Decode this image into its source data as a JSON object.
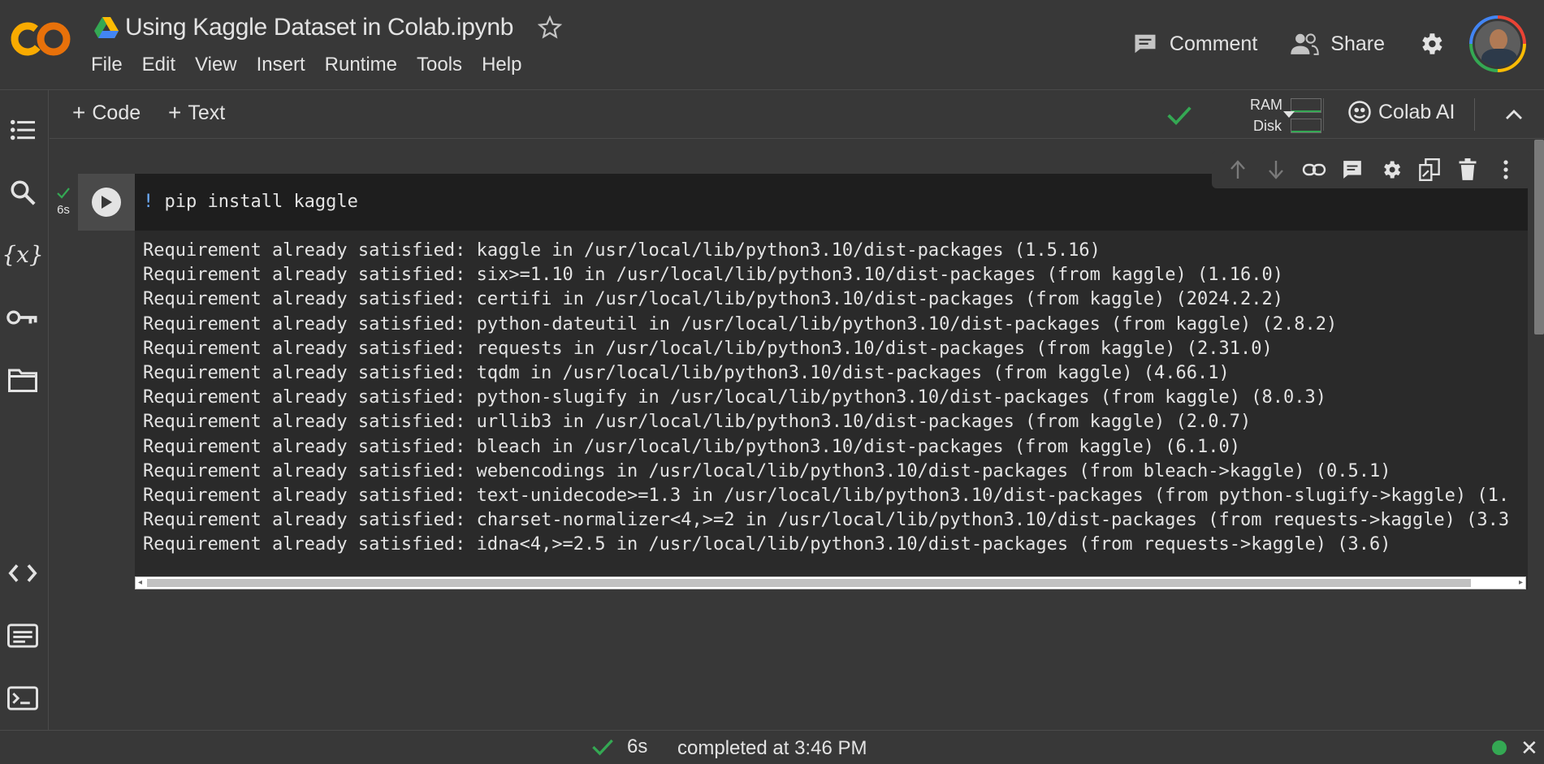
{
  "header": {
    "title": "Using Kaggle Dataset in Colab.ipynb",
    "menu": [
      "File",
      "Edit",
      "View",
      "Insert",
      "Runtime",
      "Tools",
      "Help"
    ],
    "comment_label": "Comment",
    "share_label": "Share"
  },
  "toolbar": {
    "add_code_label": "Code",
    "add_text_label": "Text",
    "ram_label": "RAM",
    "disk_label": "Disk",
    "colab_ai_label": "Colab AI"
  },
  "cell": {
    "exec_time": "6s",
    "code": "pip install kaggle",
    "code_prefix": "!",
    "output_lines": [
      "Requirement already satisfied: kaggle in /usr/local/lib/python3.10/dist-packages (1.5.16)",
      "Requirement already satisfied: six>=1.10 in /usr/local/lib/python3.10/dist-packages (from kaggle) (1.16.0)",
      "Requirement already satisfied: certifi in /usr/local/lib/python3.10/dist-packages (from kaggle) (2024.2.2)",
      "Requirement already satisfied: python-dateutil in /usr/local/lib/python3.10/dist-packages (from kaggle) (2.8.2)",
      "Requirement already satisfied: requests in /usr/local/lib/python3.10/dist-packages (from kaggle) (2.31.0)",
      "Requirement already satisfied: tqdm in /usr/local/lib/python3.10/dist-packages (from kaggle) (4.66.1)",
      "Requirement already satisfied: python-slugify in /usr/local/lib/python3.10/dist-packages (from kaggle) (8.0.3)",
      "Requirement already satisfied: urllib3 in /usr/local/lib/python3.10/dist-packages (from kaggle) (2.0.7)",
      "Requirement already satisfied: bleach in /usr/local/lib/python3.10/dist-packages (from kaggle) (6.1.0)",
      "Requirement already satisfied: webencodings in /usr/local/lib/python3.10/dist-packages (from bleach->kaggle) (0.5.1)",
      "Requirement already satisfied: text-unidecode>=1.3 in /usr/local/lib/python3.10/dist-packages (from python-slugify->kaggle) (1.",
      "Requirement already satisfied: charset-normalizer<4,>=2 in /usr/local/lib/python3.10/dist-packages (from requests->kaggle) (3.3",
      "Requirement already satisfied: idna<4,>=2.5 in /usr/local/lib/python3.10/dist-packages (from requests->kaggle) (3.6)"
    ]
  },
  "statusbar": {
    "time": "6s",
    "text": "completed at 3:46 PM"
  },
  "colors": {
    "background": "#383838",
    "output_bg": "#2a2a2a",
    "code_bg": "#1e1e1e",
    "success": "#34a853",
    "logo_orange": "#f9ab00"
  }
}
